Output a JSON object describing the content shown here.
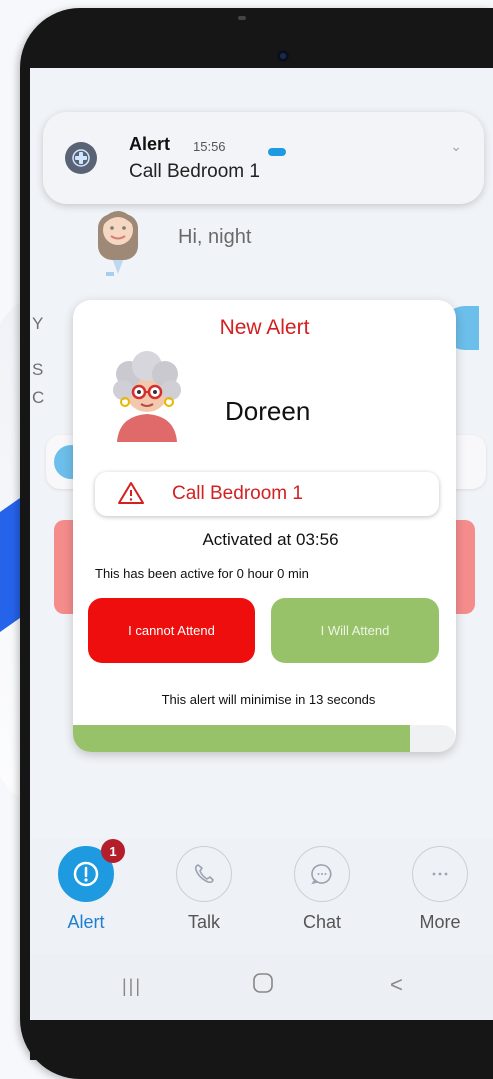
{
  "notification": {
    "title": "Alert",
    "time": "15:56",
    "message": "Call Bedroom 1"
  },
  "home": {
    "greeting": "Hi, night",
    "row_letters": [
      "Y",
      "S",
      "C"
    ]
  },
  "alert_dialog": {
    "title": "New Alert",
    "resident_name": "Doreen",
    "call_location": "Call Bedroom 1",
    "activated_text": "Activated at 03:56",
    "active_duration": "This has been active for 0 hour 0 min",
    "cannot_attend_label": "I cannot Attend",
    "will_attend_label": "I Will Attend",
    "minimise_text": "This alert will minimise in 13 seconds",
    "countdown_progress": 0.88
  },
  "tabs": [
    {
      "label": "Alert",
      "icon": "alert-icon",
      "badge": "1",
      "active": true
    },
    {
      "label": "Talk",
      "icon": "phone-icon",
      "active": false
    },
    {
      "label": "Chat",
      "icon": "chat-icon",
      "active": false
    },
    {
      "label": "More",
      "icon": "more-icon",
      "active": false
    }
  ],
  "navbar": {
    "recents": "|||",
    "home": "○",
    "back": "<"
  },
  "colors": {
    "accent": "#1e9be0",
    "danger": "#ee0e0e",
    "success": "#97c26a",
    "title_red": "#d32020",
    "badge": "#b41e2a"
  }
}
